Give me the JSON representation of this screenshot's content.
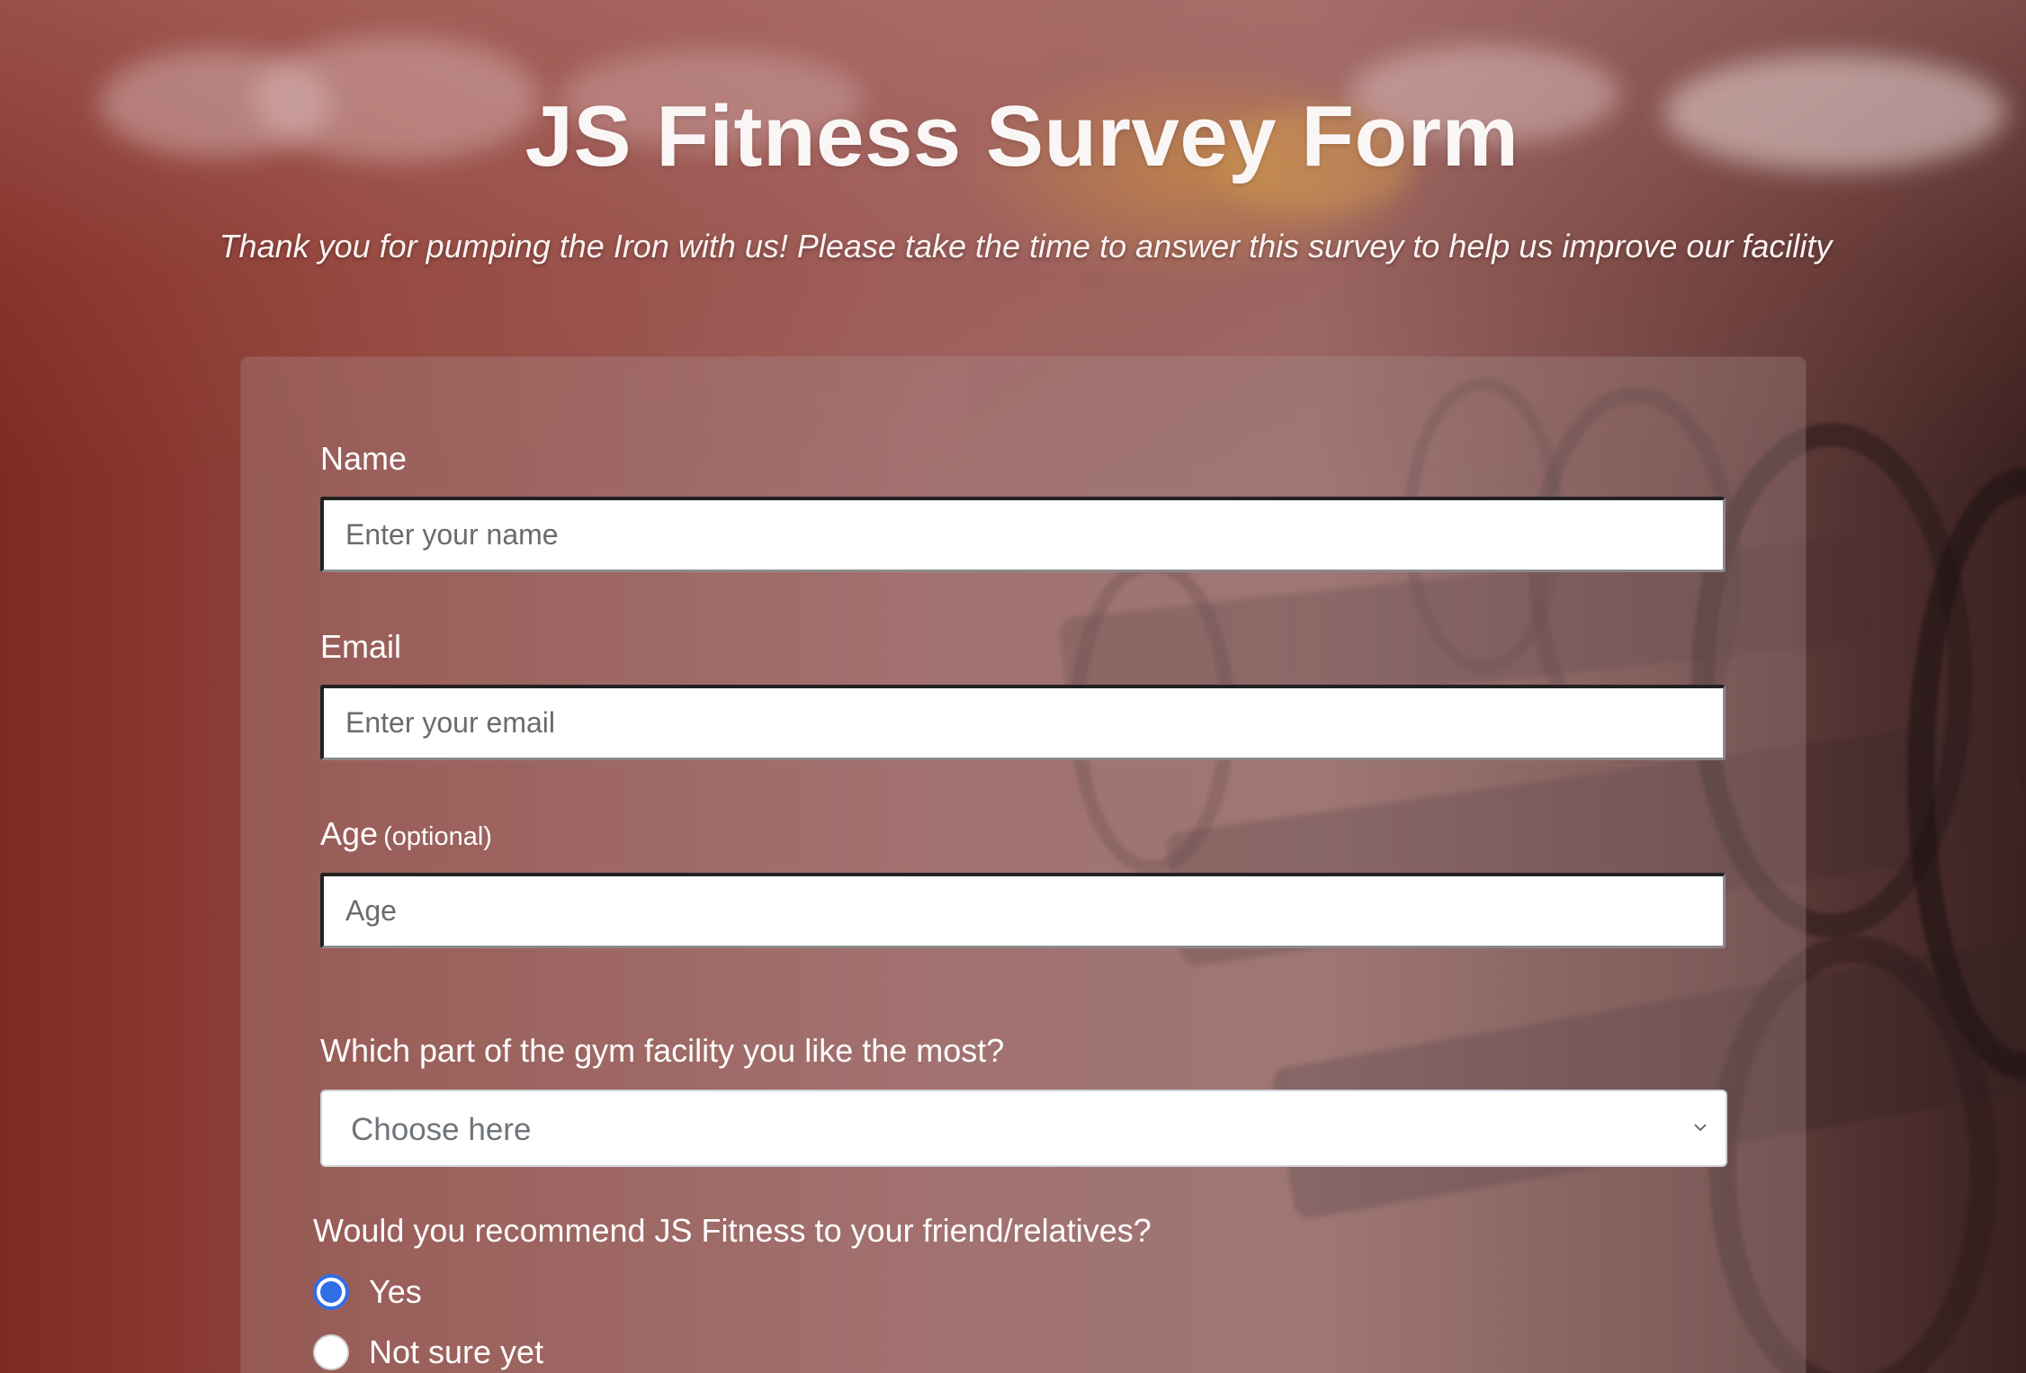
{
  "header": {
    "title": "JS Fitness Survey Form",
    "subtitle": "Thank you for pumping the Iron with us! Please take the time to answer this survey to help us improve our facility"
  },
  "form": {
    "name": {
      "label": "Name",
      "placeholder": "Enter your name",
      "value": ""
    },
    "email": {
      "label": "Email",
      "placeholder": "Enter your email",
      "value": ""
    },
    "age": {
      "label": "Age",
      "optional_note": "(optional)",
      "placeholder": "Age",
      "value": ""
    },
    "facility": {
      "label": "Which part of the gym facility you like the most?",
      "selected": "Choose here"
    },
    "recommend": {
      "question": "Would you recommend JS Fitness to your friend/relatives?",
      "options": [
        {
          "label": "Yes",
          "checked": true
        },
        {
          "label": "Not sure yet",
          "checked": false
        }
      ]
    }
  },
  "colors": {
    "accent": "#2f6fe6",
    "text": "#ffffff",
    "background_tint": "#9e6360"
  },
  "icons": {
    "select_chevron": "chevron-down-icon"
  }
}
